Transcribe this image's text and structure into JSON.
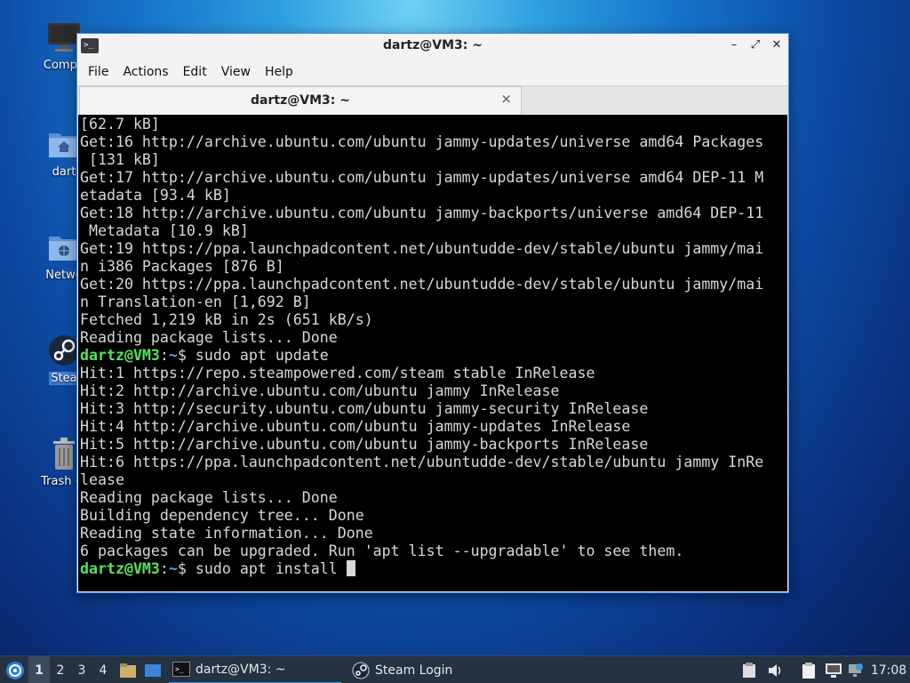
{
  "desktop": {
    "icons": [
      {
        "label": "Compu"
      },
      {
        "label": "dart"
      },
      {
        "label": "Netwo"
      },
      {
        "label": "Stea"
      },
      {
        "label": "Trash (E"
      }
    ]
  },
  "window": {
    "title": "dartz@VM3: ~",
    "menu": [
      "File",
      "Actions",
      "Edit",
      "View",
      "Help"
    ],
    "tab_title": "dartz@VM3: ~",
    "tab_close": "×",
    "controls": {
      "minimize": "–",
      "maximize": "⤢",
      "close": "✕"
    },
    "terminal": {
      "lines": [
        "[62.7 kB]",
        "Get:16 http://archive.ubuntu.com/ubuntu jammy-updates/universe amd64 Packages",
        " [131 kB]",
        "Get:17 http://archive.ubuntu.com/ubuntu jammy-updates/universe amd64 DEP-11 M",
        "etadata [93.4 kB]",
        "Get:18 http://archive.ubuntu.com/ubuntu jammy-backports/universe amd64 DEP-11",
        " Metadata [10.9 kB]",
        "Get:19 https://ppa.launchpadcontent.net/ubuntudde-dev/stable/ubuntu jammy/mai",
        "n i386 Packages [876 B]",
        "Get:20 https://ppa.launchpadcontent.net/ubuntudde-dev/stable/ubuntu jammy/mai",
        "n Translation-en [1,692 B]",
        "Fetched 1,219 kB in 2s (651 kB/s)",
        "Reading package lists... Done"
      ],
      "prompt1": {
        "user": "dartz@VM3",
        "sep": ":",
        "path": "~",
        "cmd": "$ sudo apt update"
      },
      "lines2": [
        "Hit:1 https://repo.steampowered.com/steam stable InRelease",
        "Hit:2 http://archive.ubuntu.com/ubuntu jammy InRelease",
        "Hit:3 http://security.ubuntu.com/ubuntu jammy-security InRelease",
        "Hit:4 http://archive.ubuntu.com/ubuntu jammy-updates InRelease",
        "Hit:5 http://archive.ubuntu.com/ubuntu jammy-backports InRelease",
        "Hit:6 https://ppa.launchpadcontent.net/ubuntudde-dev/stable/ubuntu jammy InRe",
        "lease",
        "Reading package lists... Done",
        "Building dependency tree... Done",
        "Reading state information... Done",
        "6 packages can be upgraded. Run 'apt list --upgradable' to see them."
      ],
      "prompt2": {
        "user": "dartz@VM3",
        "sep": ":",
        "path": "~",
        "cmd": "$ sudo apt install "
      }
    }
  },
  "taskbar": {
    "workspaces": [
      "1",
      "2",
      "3",
      "4"
    ],
    "active_workspace": "1",
    "tasks": [
      {
        "label": "dartz@VM3: ~",
        "icon": "terminal-icon"
      },
      {
        "label": "Steam Login",
        "icon": "steam-icon"
      }
    ],
    "clock": "17:08"
  },
  "colors": {
    "prompt_user": "#56e35a",
    "prompt_path": "#6a9cf0",
    "window_border": "#3d8ee8",
    "taskbar_bg": "#243241"
  }
}
